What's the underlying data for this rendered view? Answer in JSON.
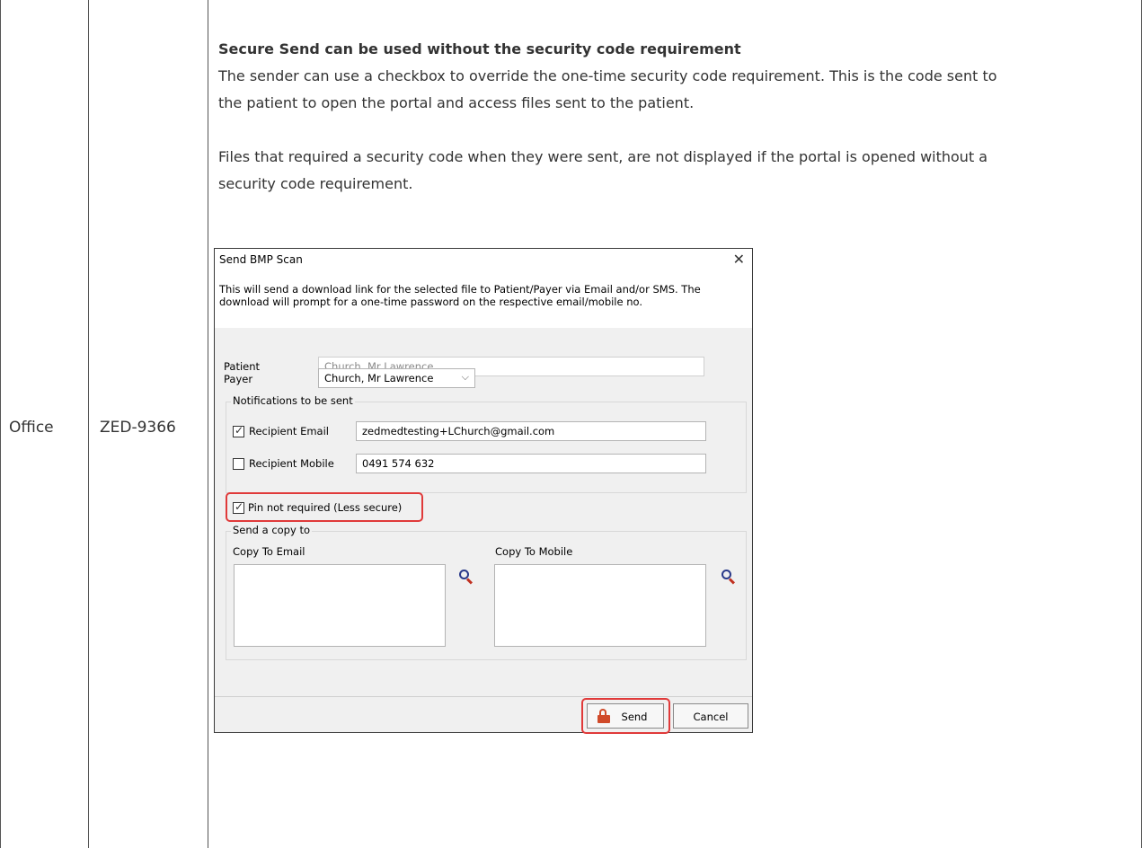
{
  "row": {
    "category": "Office",
    "id": "ZED-9366"
  },
  "article": {
    "heading": "Secure Send can be used without the security code requirement",
    "para1_line1": "The sender can use a checkbox to override the one-time security code requirement. This is the code sent to",
    "para1_line2": "the patient to open the portal and access files sent to the patient.",
    "para2_line1": "Files that required a security code when they were sent, are not displayed if the portal is opened without a",
    "para2_line2": "security code requirement."
  },
  "dialog": {
    "title": "Send BMP Scan",
    "close_glyph": "✕",
    "description": "This will send a download link for the selected file to Patient/Payer via Email and/or SMS. The download will prompt for a one-time password on the respective email/mobile no.",
    "patient_label": "Patient",
    "patient_value": "Church, Mr Lawrence",
    "payer_label": "Payer",
    "payer_value": "Church, Mr Lawrence",
    "combo_arrow": "⌵",
    "notifications_title": "Notifications to be sent",
    "recipient_email_label": "Recipient Email",
    "recipient_email_checked": true,
    "recipient_email_value": "zedmedtesting+LChurch@gmail.com",
    "recipient_mobile_label": "Recipient Mobile",
    "recipient_mobile_checked": false,
    "recipient_mobile_value": "0491 574 632",
    "pin_label": "Pin not required (Less secure)",
    "pin_checked": true,
    "copy_group_title": "Send a copy to",
    "copy_email_label": "Copy To Email",
    "copy_mobile_label": "Copy To Mobile",
    "send_label": "Send",
    "cancel_label": "Cancel",
    "tick_glyph": "✓"
  },
  "colors": {
    "highlight": "#e03a3a",
    "lock_icon": "#d04a2a",
    "search_icon_ring": "#2a3a8a"
  }
}
